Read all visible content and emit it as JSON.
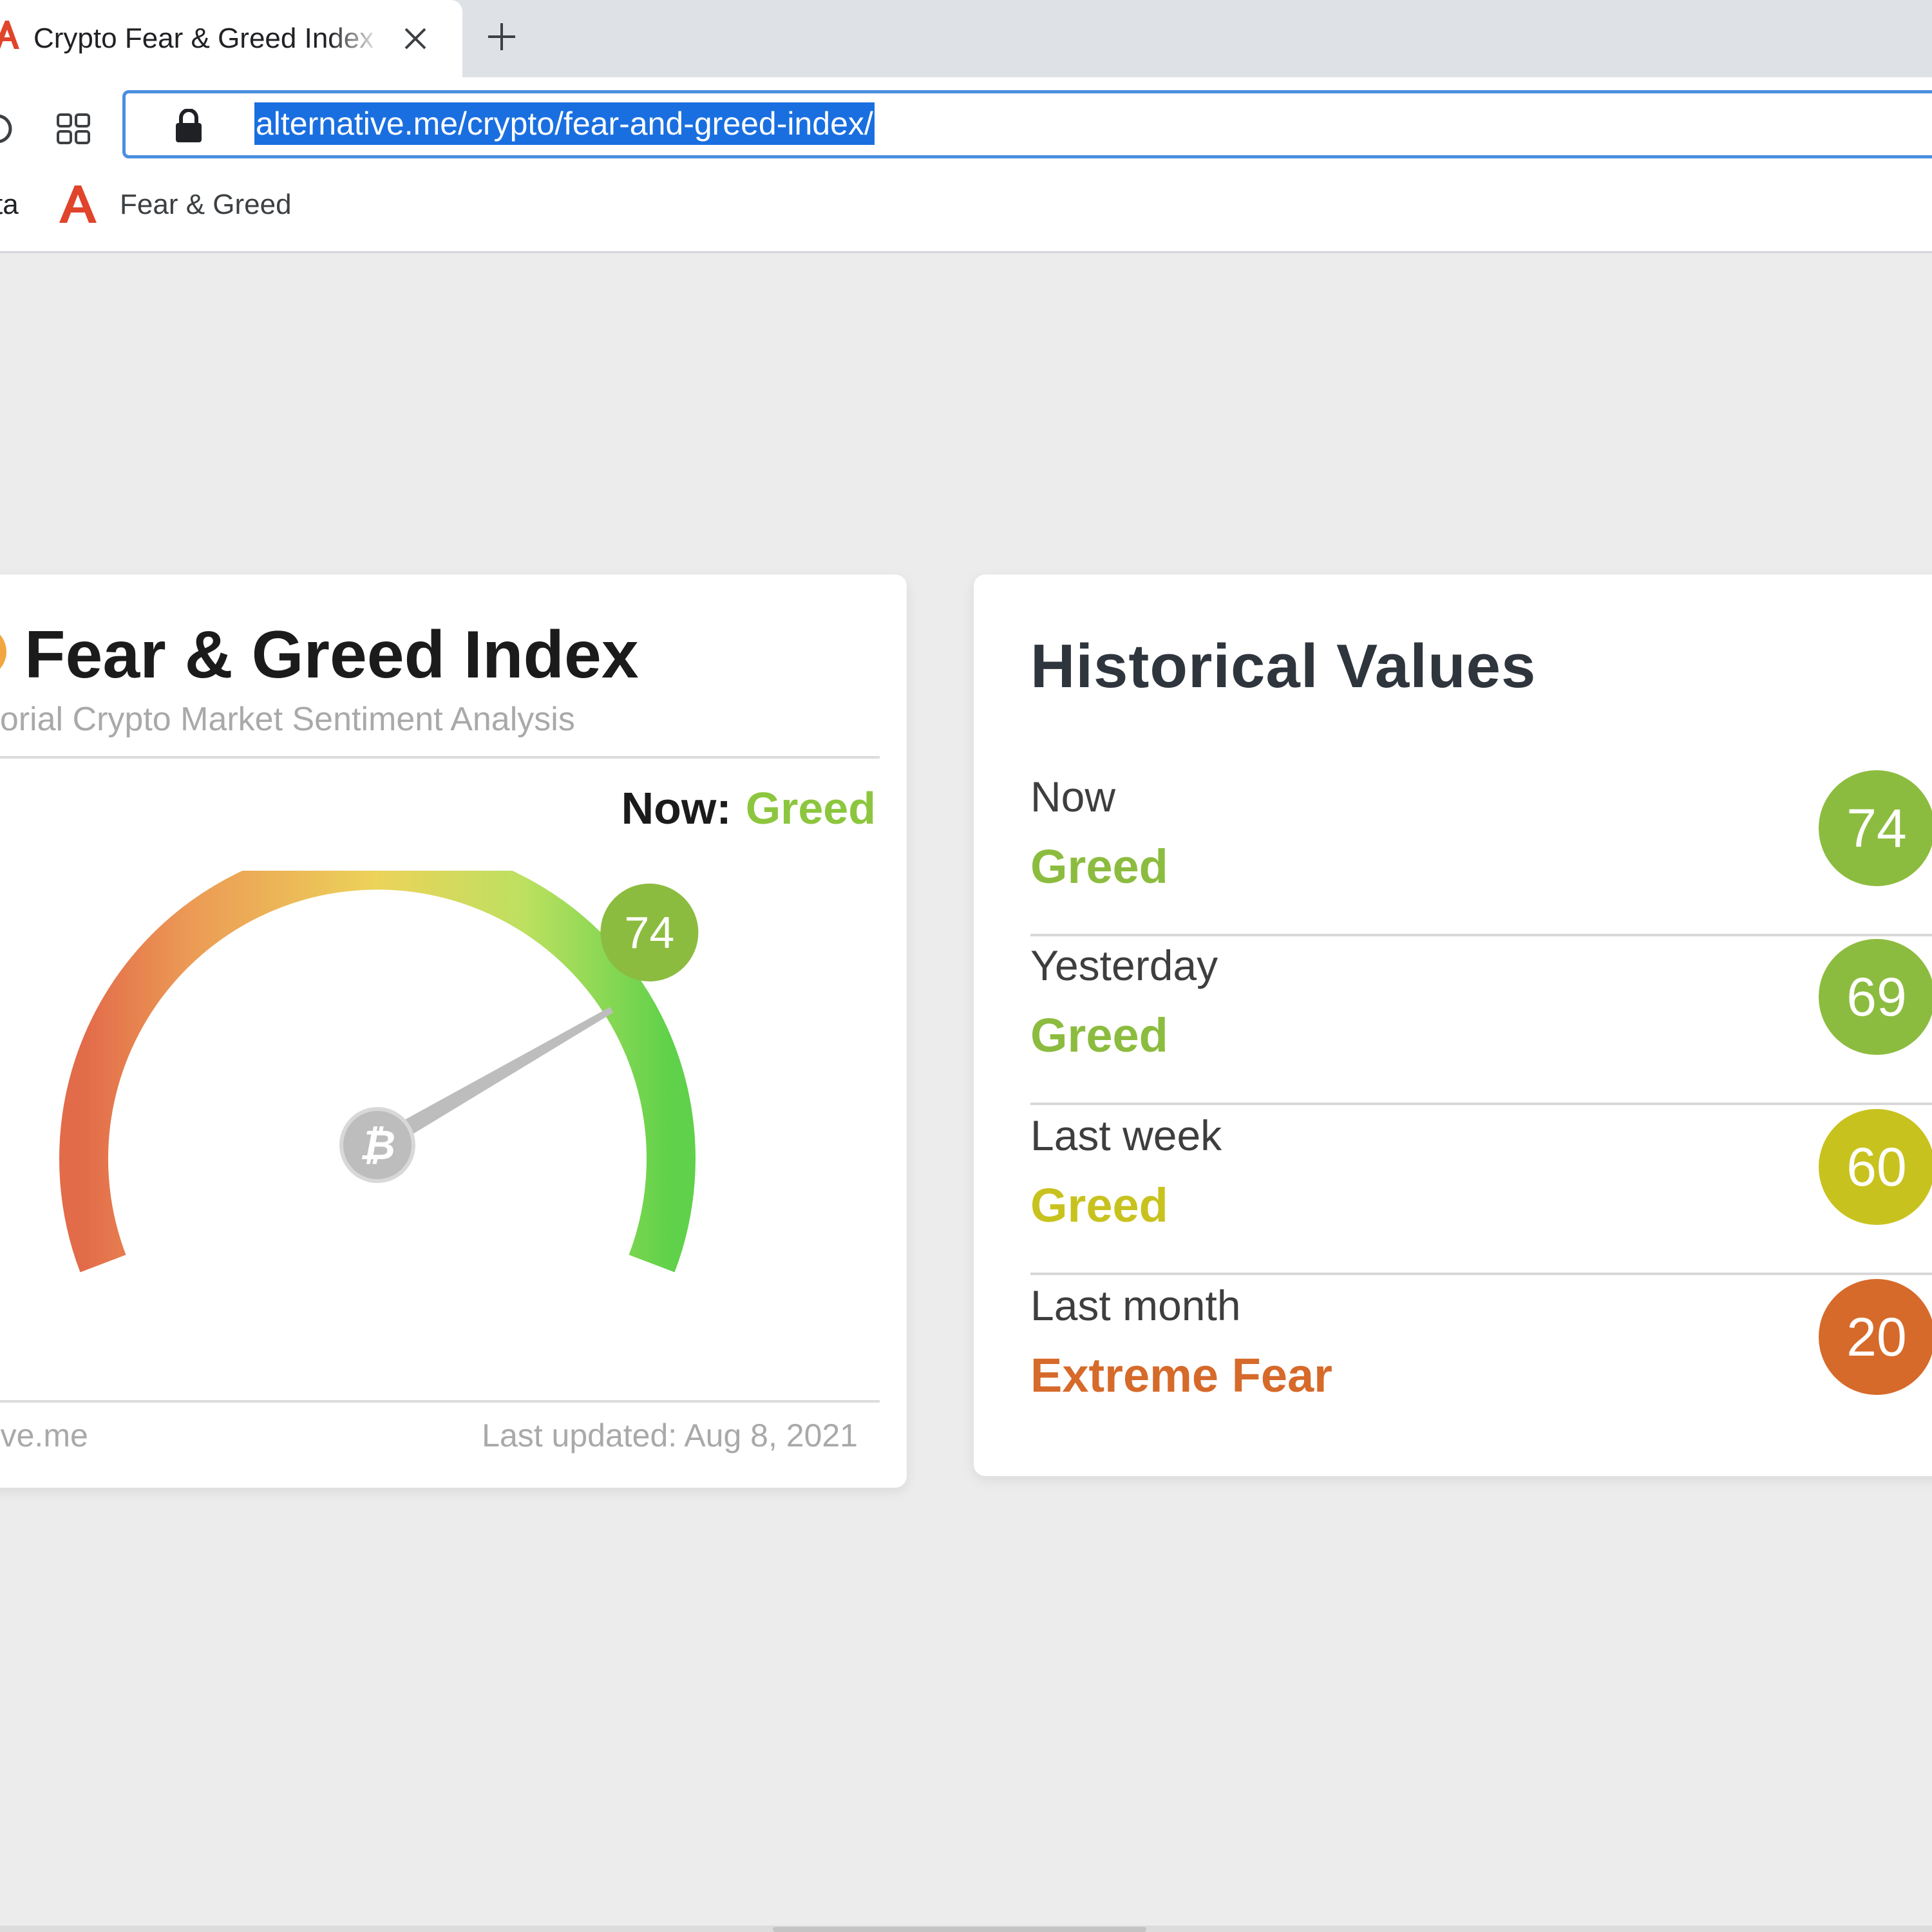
{
  "browser": {
    "tab": {
      "title": "Crypto Fear & Greed Index",
      "favicon": "alternative-me-logo-icon"
    },
    "omnibox": {
      "url": "alternative.me/crypto/fear-and-greed-index/"
    },
    "bookmarks": [
      {
        "label": "ta"
      },
      {
        "label": "Fear & Greed",
        "icon": "alternative-me-logo-icon"
      }
    ]
  },
  "fear_greed_card": {
    "title": "Fear & Greed Index",
    "subtitle": "factorial Crypto Market Sentiment Analysis",
    "now_label": "Now:",
    "now_value": "Greed",
    "gauge_badge": "74",
    "source": "native.me",
    "last_updated": "Last updated: Aug 8, 2021",
    "gauge_value": 74,
    "gauge_range": [
      0,
      100
    ],
    "hub_icon": "bitcoin-icon"
  },
  "historical": {
    "title": "Historical Values",
    "rows": [
      {
        "period": "Now",
        "classification": "Greed",
        "value": "74",
        "color": "#8cbc3f"
      },
      {
        "period": "Yesterday",
        "classification": "Greed",
        "value": "69",
        "color": "#8cbc3f"
      },
      {
        "period": "Last week",
        "classification": "Greed",
        "value": "60",
        "color": "#c8c21f"
      },
      {
        "period": "Last month",
        "classification": "Extreme Fear",
        "value": "20",
        "color": "#d66a2a"
      }
    ]
  },
  "colors": {
    "greed": "#8cc63e",
    "accent_blue": "#1a6fe0",
    "brand_red": "#e0442a"
  }
}
